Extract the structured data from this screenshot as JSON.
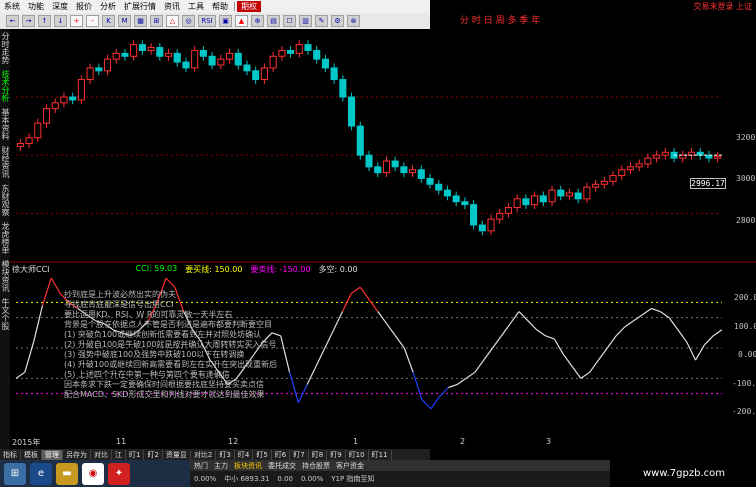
{
  "menubar": {
    "items": [
      "系统",
      "功能",
      "深度",
      "报价",
      "分析",
      "扩展行情",
      "资讯",
      "工具",
      "帮助"
    ],
    "active_tab": "期权",
    "right_text": "交易未登录 上证"
  },
  "toolbar": {
    "buttons": [
      "←",
      "→",
      "↑",
      "↓",
      "+",
      "-",
      "K",
      "M",
      "▦",
      "⊞",
      "△",
      "◎",
      "RSI",
      "▣",
      "▲",
      "⊕",
      "▤",
      "☐",
      "▥",
      "✎",
      "⚙",
      "⊗"
    ],
    "right_labels": "分 时 日 周 多 季 年"
  },
  "left_tabs": [
    "分时走势",
    "技术分析",
    "基本资料",
    "财经资讯",
    "东财观察",
    "龙虎榜单",
    "模块资讯",
    "牛文个股"
  ],
  "price_axis": {
    "labels": [
      "3200",
      "3000",
      "2800"
    ],
    "current_price": "2996.17"
  },
  "indicator": {
    "name": "徐大师CCI",
    "cci_label": "CCI: 59.03",
    "over_label": "要买线: 150.00",
    "under_label": "要卖线: -150.00",
    "empty_label": "多空: 0.00",
    "axis_labels": [
      "200.0",
      "100.0",
      "0.00",
      "-100.0",
      "-200.0"
    ]
  },
  "overlay_text": [
    "抄到底是上升波必然出实的伪夫",
    "寻找底背底最深是信号出用CCI",
    "要比运用KD、RSI、W R的可靠灵敏一天半左右",
    "背景是个股在依据点人不管是否利进是遍布都要判断要空目",
    "(1) 突破负100或继续创新低需要看到左并对照处坊确认",
    "(2) 升破自100是牛破100就是按并确认大周转转实买入信号",
    "(3) 强势中破底100及强势中跌破100以下在转调换",
    "(4) 升破100或继续回新高需要看到左在实升在突出现重新后",
    "(5) 上述四个升在中第一种与第四个要有逢确信",
    "因本条求下跌一定要确保时间根据要找底坚持要买卖点信",
    "配合MACD、SKD形成交里和判线对要才就达到最佳效果"
  ],
  "time_axis": [
    "2015年",
    "11",
    "12",
    "1",
    "2",
    "3"
  ],
  "bottom_tabs": [
    "指标",
    "模板",
    "管理",
    "另存为",
    "对比",
    "江",
    "盯1",
    "盯2",
    "资量显",
    "对比2",
    "盯3",
    "盯4",
    "盯5",
    "盯6",
    "盯7",
    "盯8",
    "盯9",
    "盯10",
    "盯11"
  ],
  "bottom_active": "管理",
  "status_strip": [
    "热门",
    "主力",
    "板块资讯",
    "委托成交",
    "持仓股票",
    "客户资金"
  ],
  "status_values": [
    "0.00%",
    "中小  6893.31",
    "0.00",
    "0.00%",
    "Y1P  指南至知"
  ],
  "watermark": "www.7gpzb.com",
  "colors": {
    "up_candle": "#ff3030",
    "down_candle": "#00c8c8",
    "cci_normal": "#e0e0e0",
    "cci_over": "#ff3030",
    "cci_under": "#2040ff",
    "grid": "#8b0000"
  },
  "chart_data": {
    "type": "line",
    "price_candles": {
      "y_unit": "index points",
      "ylim": [
        2650,
        3420
      ],
      "values": [
        3040,
        3060,
        3110,
        3160,
        3180,
        3200,
        3190,
        3260,
        3300,
        3290,
        3330,
        3350,
        3340,
        3380,
        3360,
        3370,
        3340,
        3350,
        3320,
        3300,
        3360,
        3340,
        3310,
        3330,
        3350,
        3310,
        3290,
        3260,
        3300,
        3340,
        3360,
        3350,
        3380,
        3360,
        3330,
        3300,
        3260,
        3200,
        3100,
        3000,
        2960,
        2940,
        2980,
        2960,
        2940,
        2950,
        2920,
        2900,
        2880,
        2860,
        2840,
        2830,
        2760,
        2740,
        2780,
        2800,
        2820,
        2850,
        2830,
        2860,
        2840,
        2880,
        2860,
        2870,
        2850,
        2890,
        2900,
        2910,
        2930,
        2950,
        2960,
        2970,
        2990,
        3000,
        3010,
        2990,
        3000,
        3010,
        3000,
        2990,
        2996
      ]
    },
    "cci": {
      "ylim": [
        -260,
        260
      ],
      "values": [
        -100,
        -80,
        20,
        140,
        230,
        180,
        150,
        130,
        110,
        90,
        80,
        60,
        50,
        40,
        60,
        90,
        150,
        230,
        200,
        120,
        60,
        20,
        -40,
        -80,
        -120,
        -100,
        -60,
        -20,
        20,
        50,
        40,
        -80,
        -180,
        -120,
        -60,
        0,
        60,
        120,
        180,
        200,
        160,
        120,
        80,
        40,
        0,
        -80,
        -170,
        -200,
        -160,
        -130,
        -120,
        -100,
        -80,
        -40,
        0,
        40,
        80,
        120,
        90,
        60,
        40,
        30,
        -20,
        -60,
        -100,
        -80,
        -40,
        0,
        40,
        70,
        90,
        110,
        130,
        120,
        100,
        60,
        20,
        -40,
        10,
        40,
        60
      ]
    }
  }
}
